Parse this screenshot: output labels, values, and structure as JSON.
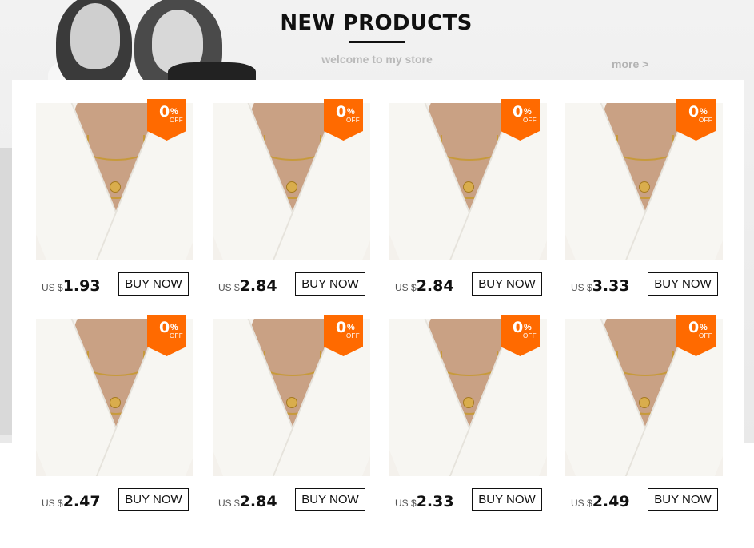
{
  "header": {
    "title": "NEW PRODUCTS",
    "subtitle": "welcome to my store",
    "more_link": "more >"
  },
  "colors": {
    "badge": "#ff6a00",
    "accent": "#111111",
    "subtle_text": "#b9b9b9"
  },
  "products": [
    {
      "currency": "US $",
      "price": "1.93",
      "discount": "0",
      "pct": "%",
      "off": "OFF",
      "button": "BUY NOW"
    },
    {
      "currency": "US $",
      "price": "2.84",
      "discount": "0",
      "pct": "%",
      "off": "OFF",
      "button": "BUY NOW"
    },
    {
      "currency": "US $",
      "price": "2.84",
      "discount": "0",
      "pct": "%",
      "off": "OFF",
      "button": "BUY NOW"
    },
    {
      "currency": "US $",
      "price": "3.33",
      "discount": "0",
      "pct": "%",
      "off": "OFF",
      "button": "BUY NOW"
    },
    {
      "currency": "US $",
      "price": "2.47",
      "discount": "0",
      "pct": "%",
      "off": "OFF",
      "button": "BUY NOW"
    },
    {
      "currency": "US $",
      "price": "2.84",
      "discount": "0",
      "pct": "%",
      "off": "OFF",
      "button": "BUY NOW"
    },
    {
      "currency": "US $",
      "price": "2.33",
      "discount": "0",
      "pct": "%",
      "off": "OFF",
      "button": "BUY NOW"
    },
    {
      "currency": "US $",
      "price": "2.49",
      "discount": "0",
      "pct": "%",
      "off": "OFF",
      "button": "BUY NOW"
    }
  ]
}
